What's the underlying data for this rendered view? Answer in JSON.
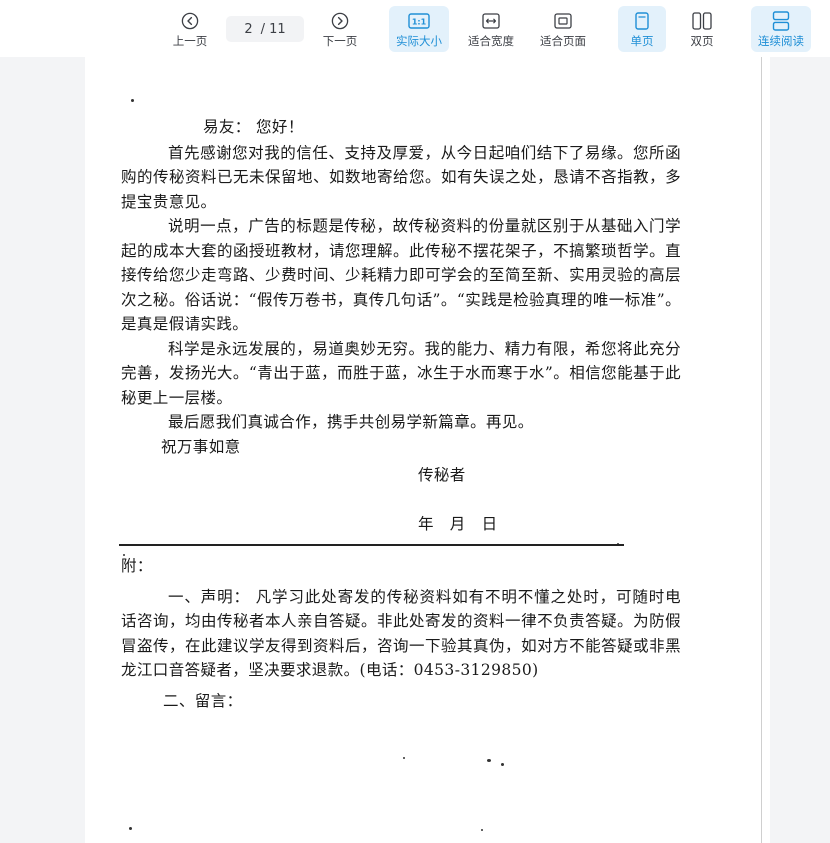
{
  "toolbar": {
    "prev_label": "上一页",
    "next_label": "下一页",
    "page_current": "2",
    "page_total": "/ 11",
    "actual_size_label": "实际大小",
    "fit_width_label": "适合宽度",
    "fit_page_label": "适合页面",
    "single_page_label": "单页",
    "double_page_label": "双页",
    "continuous_label": "连续阅读",
    "accent_color": "#1f8fd6",
    "active_bg": "#e3f1fb"
  },
  "document": {
    "greeting": "易友： 您好！",
    "para1": "首先感谢您对我的信任、支持及厚爱，从今日起咱们结下了易缘。您所函购的传秘资料已无未保留地、如数地寄给您。如有失误之处，恳请不吝指教，多提宝贵意见。",
    "para2": "说明一点，广告的标题是传秘，故传秘资料的份量就区别于从基础入门学起的成本大套的函授班教材，请您理解。此传秘不摆花架子，不搞繁琐哲学。直接传给您少走弯路、少费时间、少耗精力即可学会的至简至新、实用灵验的高层次之秘。俗话说：“假传万卷书，真传几句话”。“实践是检验真理的唯一标准”。是真是假请实践。",
    "para3": "科学是永远发展的，易道奥妙无穷。我的能力、精力有限，希您将此充分完善，发扬光大。“青出于蓝，而胜于蓝，冰生于水而寒于水”。相信您能基于此秘更上一层楼。",
    "para4": "最后愿我们真诚合作，携手共创易学新篇章。再见。",
    "wish": "祝万事如意",
    "signer": "传秘者",
    "date": "年　月　日",
    "appendix_label": "附：",
    "note1": "一、声明： 凡学习此处寄发的传秘资料如有不明不懂之处时，可随时电话咨询，均由传秘者本人亲自答疑。非此处寄发的资料一律不负责答疑。为防假冒盗传，在此建议学友得到资料后，咨询一下验其真伪，如对方不能答疑或非黑龙江口音答疑者，坚决要求退款。(电话：0453-3129850)",
    "note2": "二、留言："
  }
}
